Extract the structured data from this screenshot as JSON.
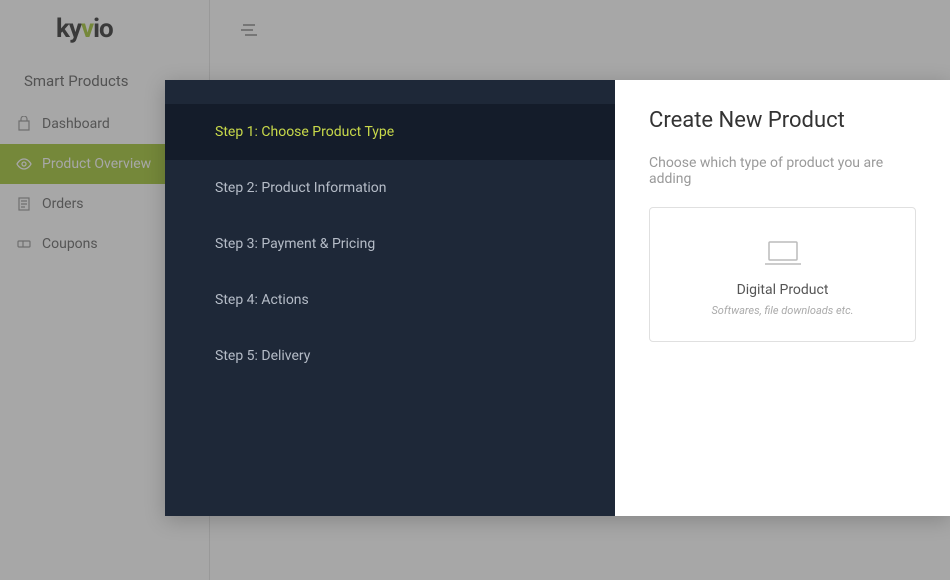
{
  "logo": {
    "part1": "ky",
    "part2": "v",
    "part3": "io"
  },
  "sidebar": {
    "section_title": "Smart Products",
    "items": [
      {
        "label": "Dashboard"
      },
      {
        "label": "Product Overview"
      },
      {
        "label": "Orders"
      },
      {
        "label": "Coupons"
      }
    ]
  },
  "modal": {
    "title": "Create New Product",
    "subtitle": "Choose which type of product you are adding",
    "steps": [
      {
        "label": "Step 1: Choose Product Type"
      },
      {
        "label": "Step 2: Product Information"
      },
      {
        "label": "Step 3: Payment & Pricing"
      },
      {
        "label": "Step 4: Actions"
      },
      {
        "label": "Step 5: Delivery"
      }
    ],
    "product_card": {
      "title": "Digital Product",
      "desc": "Softwares, file downloads etc."
    }
  }
}
